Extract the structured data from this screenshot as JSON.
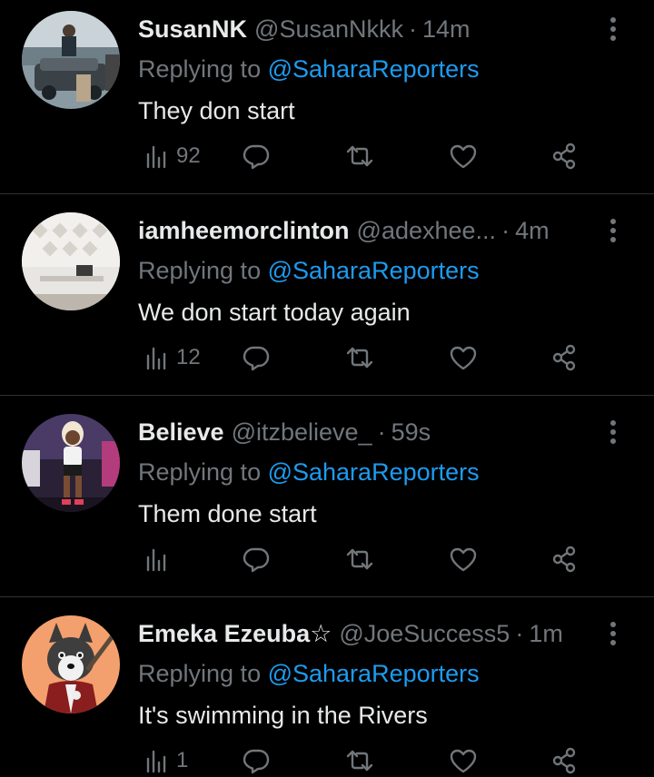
{
  "tweets": [
    {
      "name": "SusanNK",
      "handle": "@SusanNkkk",
      "time": "14m",
      "replying_prefix": "Replying to ",
      "replying_to": "@SaharaReporters",
      "text": "They don start",
      "views": "92"
    },
    {
      "name": "iamheemorclinton",
      "handle": "@adexhee...",
      "time": "4m",
      "replying_prefix": "Replying to ",
      "replying_to": "@SaharaReporters",
      "text": "We don start today again",
      "views": "12"
    },
    {
      "name": "Believe",
      "handle": "@itzbelieve_",
      "time": "59s",
      "replying_prefix": "Replying to ",
      "replying_to": "@SaharaReporters",
      "text": "Them done start",
      "views": ""
    },
    {
      "name": "Emeka Ezeuba☆",
      "handle": "@JoeSuccess5",
      "time": "1m",
      "replying_prefix": "Replying to ",
      "replying_to": "@SaharaReporters",
      "text": "It's swimming in the Rivers",
      "views": "1"
    }
  ],
  "separator": "·",
  "colors": {
    "background": "#000000",
    "primary_text": "#e7e9ea",
    "secondary_text": "#71767b",
    "link": "#1d9bf0",
    "divider": "#2f3336"
  },
  "icons": [
    "views-icon",
    "reply-icon",
    "retweet-icon",
    "like-icon",
    "share-icon",
    "more-icon"
  ]
}
